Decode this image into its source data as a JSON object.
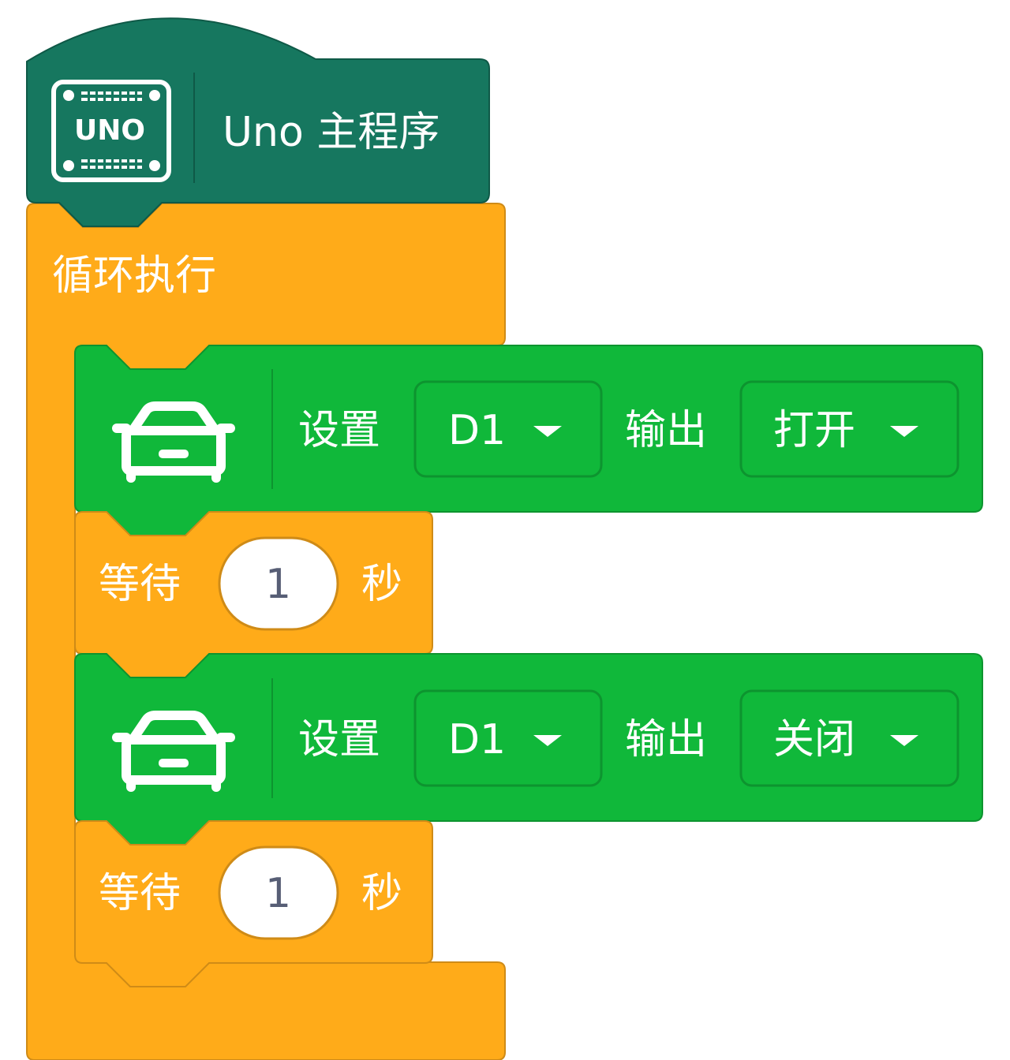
{
  "hat_block": {
    "icon": "uno-board-icon",
    "icon_text": "UNO",
    "label": "Uno 主程序",
    "color": "#16775F"
  },
  "loop_block": {
    "label": "循环执行",
    "color": "#FFAB19"
  },
  "pin_blocks": [
    {
      "icon": "car-icon",
      "set_label": "设置",
      "pin_value": "D1",
      "output_label": "输出",
      "state_value": "打开",
      "color": "#10B83A"
    },
    {
      "icon": "car-icon",
      "set_label": "设置",
      "pin_value": "D1",
      "output_label": "输出",
      "state_value": "关闭",
      "color": "#10B83A"
    }
  ],
  "wait_blocks": [
    {
      "wait_label": "等待",
      "seconds": "1",
      "unit_label": "秒"
    },
    {
      "wait_label": "等待",
      "seconds": "1",
      "unit_label": "秒"
    }
  ]
}
